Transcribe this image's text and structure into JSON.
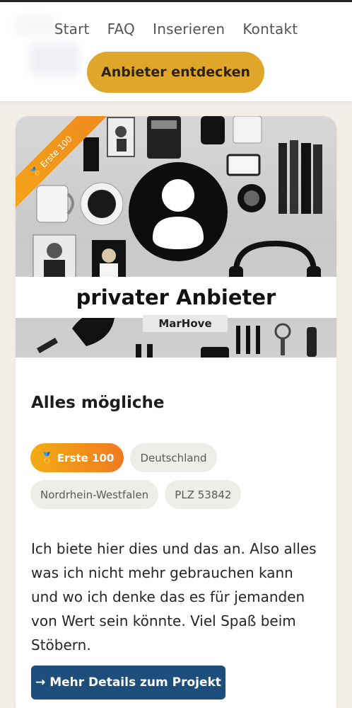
{
  "nav": {
    "items": [
      "Start",
      "FAQ",
      "Inserieren",
      "Kontakt"
    ],
    "cta_label": "Anbieter entdecken"
  },
  "card": {
    "ribbon_label": "🏅 Erste 100",
    "image_label": "privater Anbieter",
    "image_brand": "MarHove",
    "title": "Alles mögliche",
    "tags": [
      "🏅 Erste 100",
      "Deutschland",
      "Nordrhein-Westfalen",
      "PLZ 53842"
    ],
    "description": "Ich biete hier dies und das an. Also alles was ich nicht mehr gebrauchen kann und wo ich denke das es für jemanden von Wert sein könnte. Viel Spaß beim Stöbern.",
    "details_button": "→ Mehr Details zum Projekt"
  },
  "colors": {
    "accent": "#e0a62a",
    "button_blue": "#1e4f7c",
    "background": "#f1eee8"
  }
}
